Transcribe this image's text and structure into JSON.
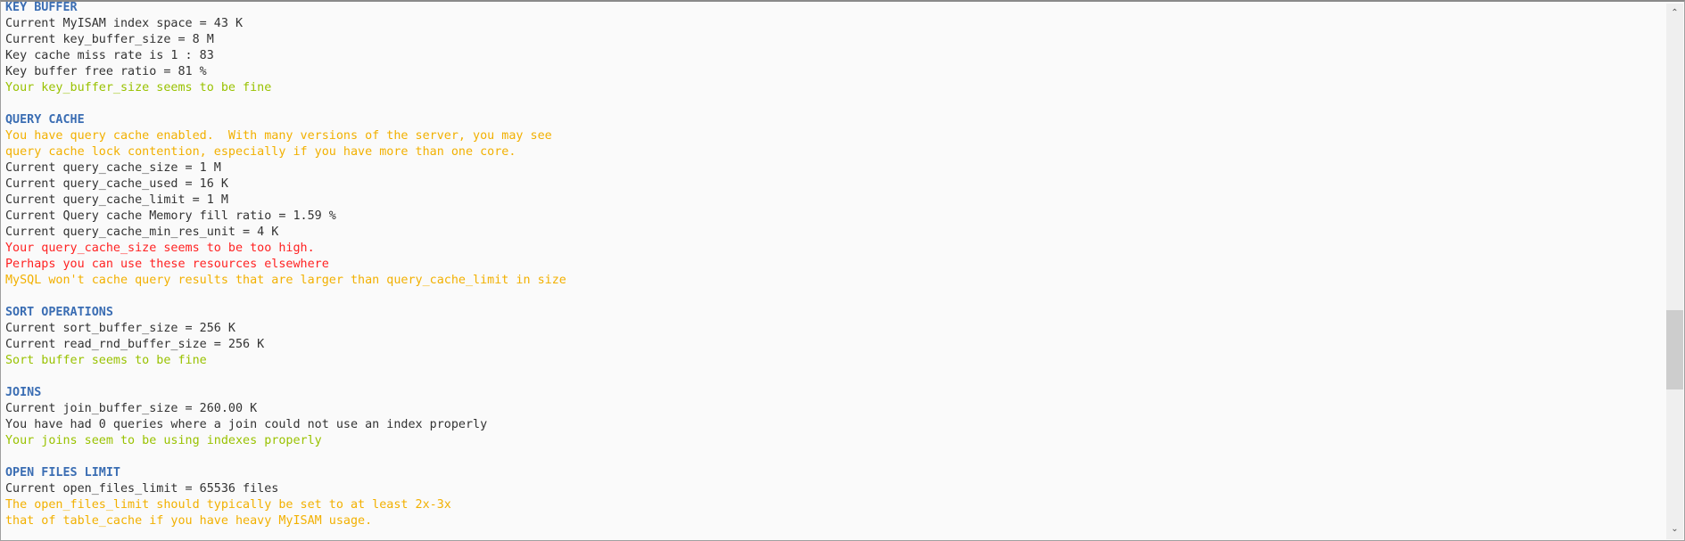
{
  "lines": [
    {
      "text": "KEY BUFFER",
      "type": "h"
    },
    {
      "text": "Current MyISAM index space = 43 K",
      "type": "n"
    },
    {
      "text": "Current key_buffer_size = 8 M",
      "type": "n"
    },
    {
      "text": "Key cache miss rate is 1 : 83",
      "type": "n"
    },
    {
      "text": "Key buffer free ratio = 81 %",
      "type": "n"
    },
    {
      "text": "Your key_buffer_size seems to be fine",
      "type": "ok"
    },
    {
      "text": "",
      "type": "n"
    },
    {
      "text": "QUERY CACHE",
      "type": "h"
    },
    {
      "text": "You have query cache enabled.  With many versions of the server, you may see",
      "type": "warn"
    },
    {
      "text": "query cache lock contention, especially if you have more than one core.",
      "type": "warn"
    },
    {
      "text": "Current query_cache_size = 1 M",
      "type": "n"
    },
    {
      "text": "Current query_cache_used = 16 K",
      "type": "n"
    },
    {
      "text": "Current query_cache_limit = 1 M",
      "type": "n"
    },
    {
      "text": "Current Query cache Memory fill ratio = 1.59 %",
      "type": "n"
    },
    {
      "text": "Current query_cache_min_res_unit = 4 K",
      "type": "n"
    },
    {
      "text": "Your query_cache_size seems to be too high.",
      "type": "bad"
    },
    {
      "text": "Perhaps you can use these resources elsewhere",
      "type": "bad"
    },
    {
      "text": "MySQL won't cache query results that are larger than query_cache_limit in size",
      "type": "warn"
    },
    {
      "text": "",
      "type": "n"
    },
    {
      "text": "SORT OPERATIONS",
      "type": "h"
    },
    {
      "text": "Current sort_buffer_size = 256 K",
      "type": "n"
    },
    {
      "text": "Current read_rnd_buffer_size = 256 K",
      "type": "n"
    },
    {
      "text": "Sort buffer seems to be fine",
      "type": "ok"
    },
    {
      "text": "",
      "type": "n"
    },
    {
      "text": "JOINS",
      "type": "h"
    },
    {
      "text": "Current join_buffer_size = 260.00 K",
      "type": "n"
    },
    {
      "text": "You have had 0 queries where a join could not use an index properly",
      "type": "n"
    },
    {
      "text": "Your joins seem to be using indexes properly",
      "type": "ok"
    },
    {
      "text": "",
      "type": "n"
    },
    {
      "text": "OPEN FILES LIMIT",
      "type": "h"
    },
    {
      "text": "Current open_files_limit = 65536 files",
      "type": "n"
    },
    {
      "text": "The open_files_limit should typically be set to at least 2x-3x",
      "type": "warn"
    },
    {
      "text": "that of table_cache if you have heavy MyISAM usage.",
      "type": "warn"
    }
  ],
  "colors": {
    "heading": "#3a6db3",
    "ok": "#99c200",
    "warn": "#f2b000",
    "bad": "#ff2222",
    "text": "#333333"
  },
  "scrollbar": {
    "position_fraction": 0.75,
    "up_icon": "chevron-up-icon",
    "down_icon": "chevron-down-icon"
  }
}
